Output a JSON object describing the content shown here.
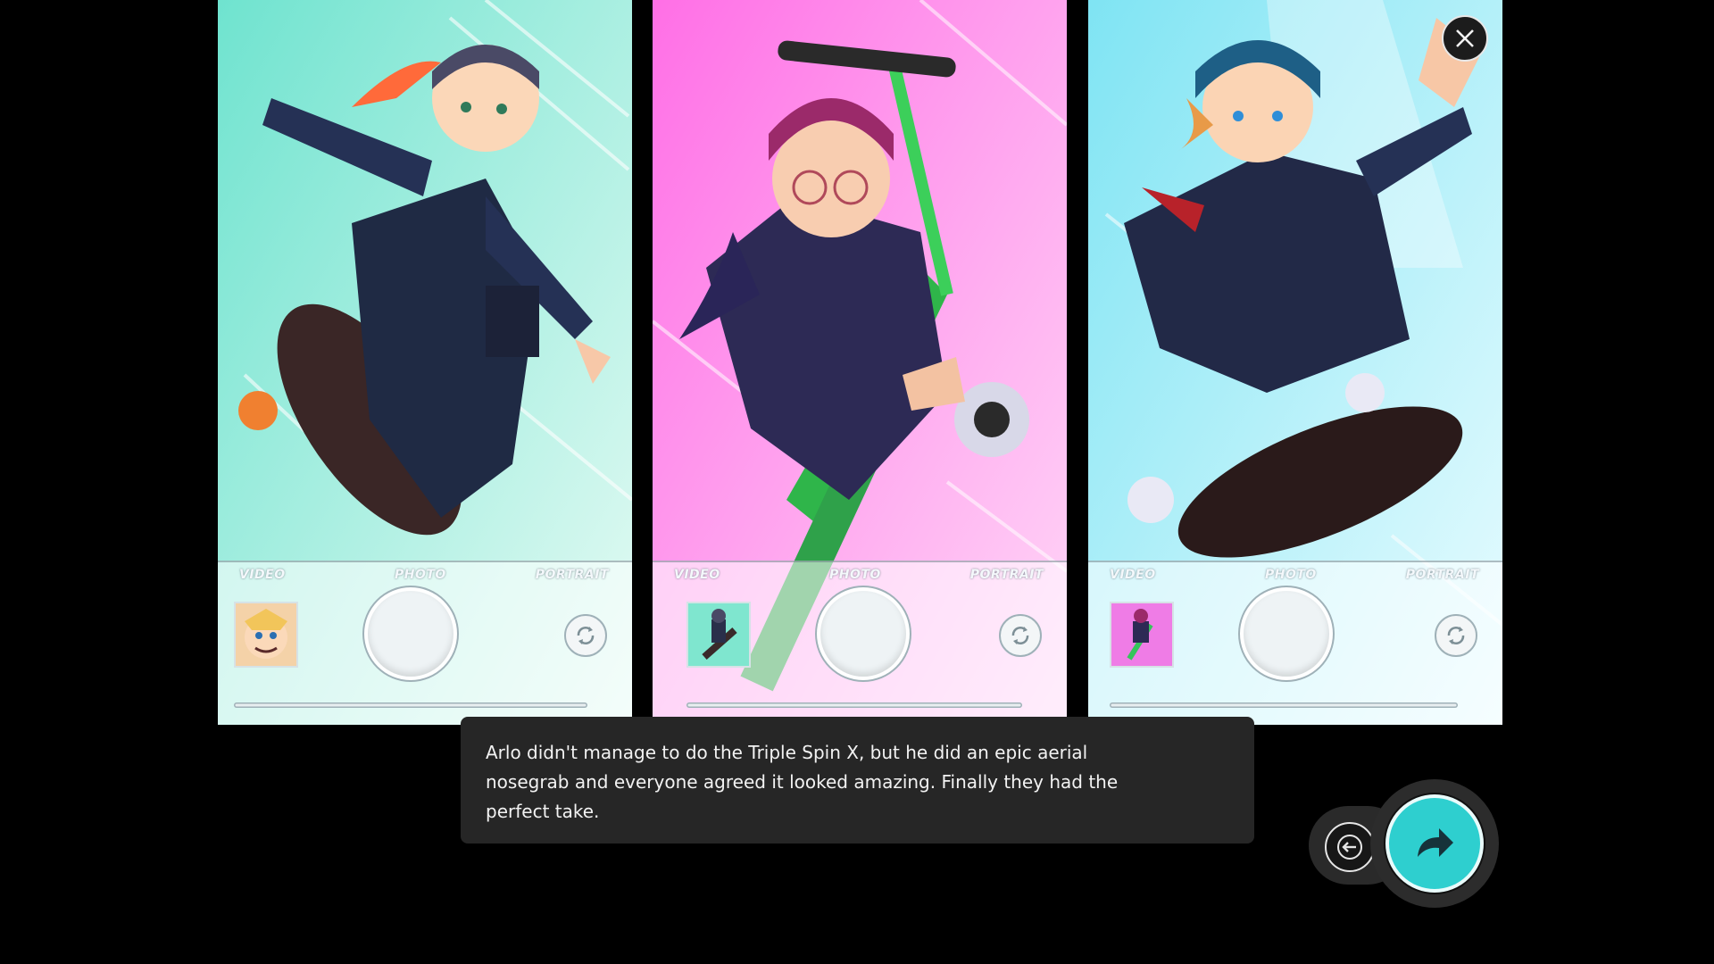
{
  "panels": [
    {
      "modes": {
        "video": "VIDEO",
        "photo": "PHOTO",
        "portrait": "PORTRAIT"
      },
      "bg_colors": [
        "#7be6d4",
        "#d9f7ee"
      ]
    },
    {
      "modes": {
        "video": "VIDEO",
        "photo": "PHOTO",
        "portrait": "PORTRAIT"
      },
      "bg_colors": [
        "#ff7be8",
        "#ffd2f6"
      ]
    },
    {
      "modes": {
        "video": "VIDEO",
        "photo": "PHOTO",
        "portrait": "PORTRAIT"
      },
      "bg_colors": [
        "#8ee7f5",
        "#e4fbff"
      ]
    }
  ],
  "caption": {
    "text": "Arlo didn't manage to do the Triple Spin X, but he did an epic aerial nosegrab and everyone agreed it looked amazing. Finally they had the perfect take."
  },
  "controls": {
    "close_icon": "close-icon",
    "back_icon": "arrow-left-icon",
    "next_icon": "redo-arrow-icon",
    "accent": "#2ecfcf"
  }
}
